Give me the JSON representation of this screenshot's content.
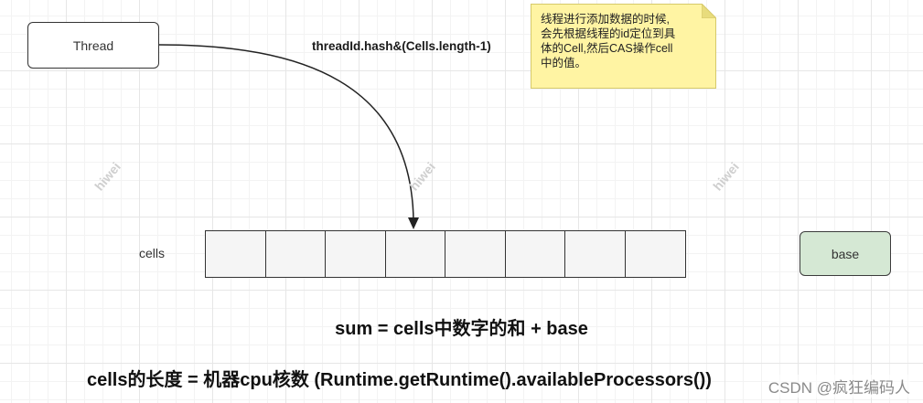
{
  "thread_box": {
    "label": "Thread"
  },
  "arrow_label": "threadId.hash&(Cells.length-1)",
  "note": {
    "text": "线程进行添加数据的时候,\n会先根据线程的id定位到具\n体的Cell,然后CAS操作cell\n中的值。",
    "color": "#fff4a3"
  },
  "cells": {
    "label": "cells",
    "count": 8
  },
  "base_box": {
    "label": "base",
    "color": "#d5e8d4"
  },
  "sum_formula": "sum = cells中数字的和 + base",
  "length_formula": "cells的长度 = 机器cpu核数 (Runtime.getRuntime().availableProcessors())",
  "watermarks": [
    "hiwei",
    "hiwei",
    "hiwei"
  ],
  "attribution": "CSDN @疯狂编码人"
}
